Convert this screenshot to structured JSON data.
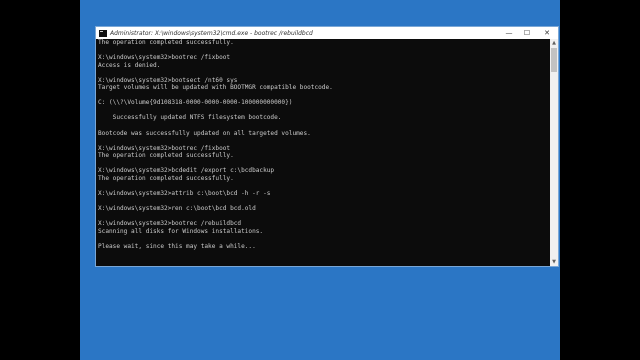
{
  "window": {
    "title": "Administrator: X:\\windows\\system32\\cmd.exe - bootrec  /rebuildbcd",
    "minimize_glyph": "—",
    "maximize_glyph": "☐",
    "close_glyph": "✕"
  },
  "console": {
    "lines": [
      "The operation completed successfully.",
      "",
      "X:\\windows\\system32>bootrec /fixboot",
      "Access is denied.",
      "",
      "X:\\windows\\system32>bootsect /nt60 sys",
      "Target volumes will be updated with BOOTMGR compatible bootcode.",
      "",
      "C: (\\\\?\\Volume{9d108318-0000-0000-0000-100000000000})",
      "",
      "    Successfully updated NTFS filesystem bootcode.",
      "",
      "Bootcode was successfully updated on all targeted volumes.",
      "",
      "X:\\windows\\system32>bootrec /fixboot",
      "The operation completed successfully.",
      "",
      "X:\\windows\\system32>bcdedit /export c:\\bcdbackup",
      "The operation completed successfully.",
      "",
      "X:\\windows\\system32>attrib c:\\boot\\bcd -h -r -s",
      "",
      "X:\\windows\\system32>ren c:\\boot\\bcd bcd.old",
      "",
      "X:\\windows\\system32>bootrec /rebuildbcd",
      "Scanning all disks for Windows installations.",
      "",
      "Please wait, since this may take a while..."
    ]
  },
  "scrollbar": {
    "up_glyph": "▲",
    "down_glyph": "▼"
  },
  "colors": {
    "desktop": "#2b76c5",
    "console_bg": "#0c0c0c",
    "console_text": "#cccccc"
  }
}
